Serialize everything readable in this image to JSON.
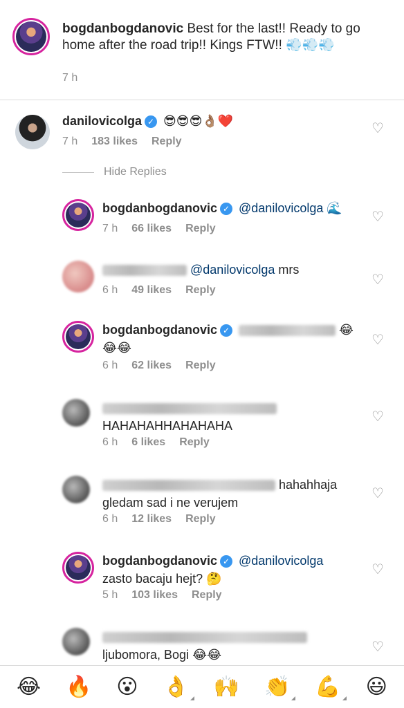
{
  "caption": {
    "username": "bogdanbogdanovic",
    "text": "Best for the last!! Ready to go home after the road trip!! Kings FTW!! 💨💨💨",
    "time": "7 h"
  },
  "hide_replies": "Hide Replies",
  "comments": [
    {
      "username": "danilovicolga",
      "text": "😎😎😎👌🏽❤️",
      "time": "7 h",
      "likes": "183 likes",
      "reply": "Reply"
    },
    {
      "username": "bogdanbogdanovic",
      "mention": "@danilovicolga",
      "text": "🌊",
      "time": "7 h",
      "likes": "66 likes",
      "reply": "Reply"
    },
    {
      "mention": "@danilovicolga",
      "text": "mrs",
      "time": "6 h",
      "likes": "49 likes",
      "reply": "Reply"
    },
    {
      "username": "bogdanbogdanovic",
      "text": "😂😂😂",
      "time": "6 h",
      "likes": "62 likes",
      "reply": "Reply"
    },
    {
      "text": "HAHAHAHHAHAHAHA",
      "time": "6 h",
      "likes": "6 likes",
      "reply": "Reply"
    },
    {
      "text": "hahahhaja gledam sad i ne verujem",
      "time": "6 h",
      "likes": "12 likes",
      "reply": "Reply"
    },
    {
      "username": "bogdanbogdanovic",
      "mention": "@danilovicolga",
      "text": "zasto bacaju hejt? 🤔",
      "time": "5 h",
      "likes": "103 likes",
      "reply": "Reply"
    },
    {
      "text": "ljubomora, Bogi 😂😂"
    }
  ],
  "emoji_bar": [
    "😂",
    "🔥",
    "😮",
    "👌",
    "🙌",
    "👏",
    "💪",
    "😃"
  ]
}
